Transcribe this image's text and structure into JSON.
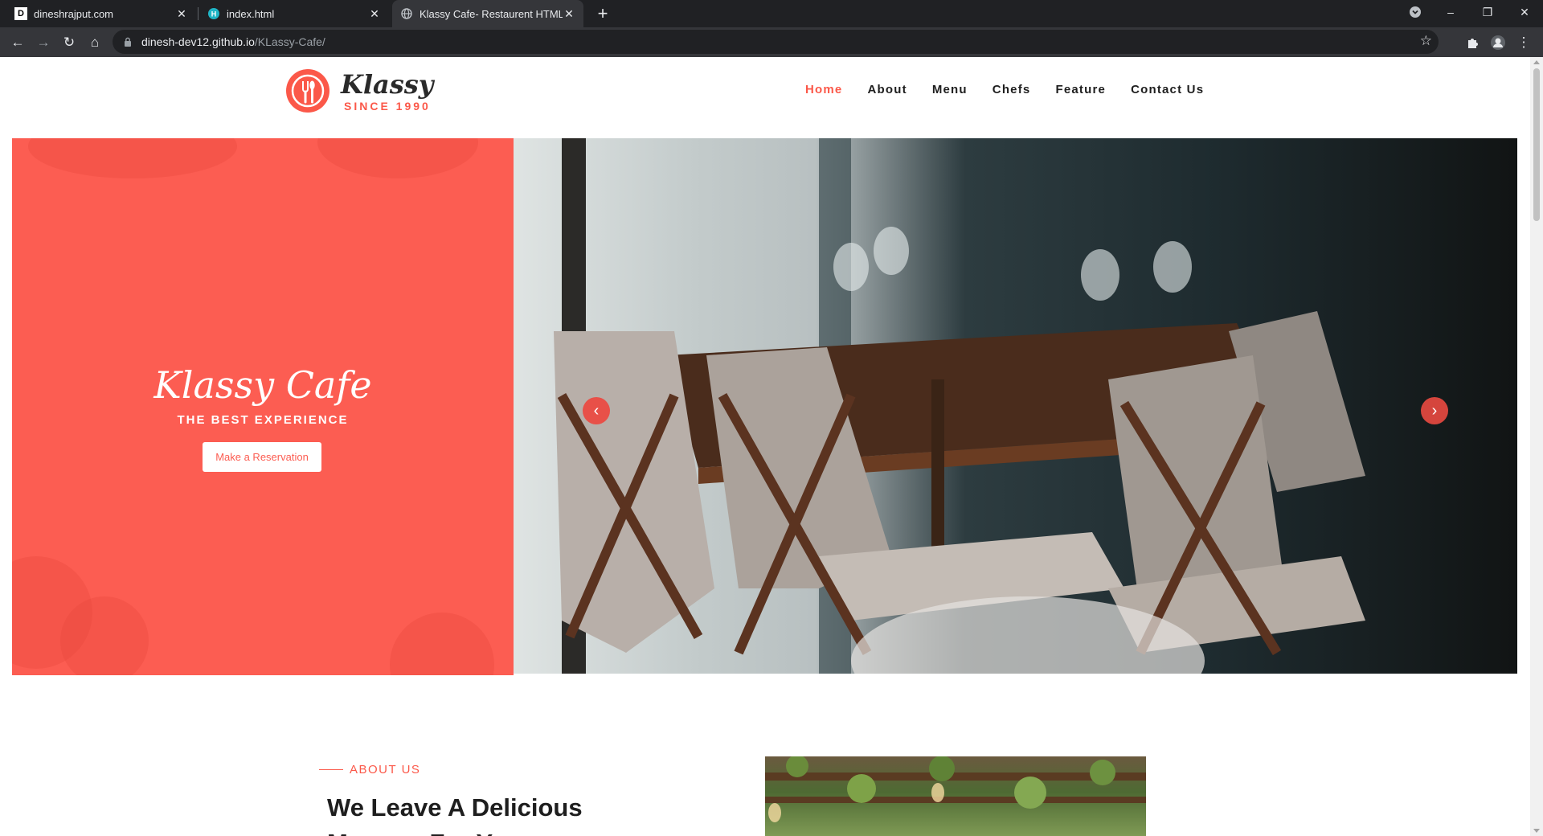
{
  "browser": {
    "tabs": [
      {
        "title": "dineshrajput.com",
        "favicon": "D"
      },
      {
        "title": "index.html",
        "favicon": "H"
      },
      {
        "title": "Klassy Cafe- Restaurent HTML Te",
        "favicon": "globe"
      }
    ],
    "url_host": "dinesh-dev12.github.io",
    "url_path": "/KLassy-Cafe/"
  },
  "site": {
    "logo_name": "Klassy",
    "logo_since": "SINCE 1990",
    "nav": [
      "Home",
      "About",
      "Menu",
      "Chefs",
      "Feature",
      "Contact Us"
    ],
    "active_nav": "Home"
  },
  "hero": {
    "title": "Klassy Cafe",
    "subtitle": "THE BEST EXPERIENCE",
    "button": "Make a Reservation"
  },
  "about": {
    "kicker": "ABOUT US",
    "heading": "We Leave A Delicious",
    "heading2": "Memory For You"
  },
  "colors": {
    "accent": "#fb5849",
    "hero_left": "#fc5d52",
    "chrome_dark": "#202124",
    "chrome_tab": "#35363a"
  }
}
